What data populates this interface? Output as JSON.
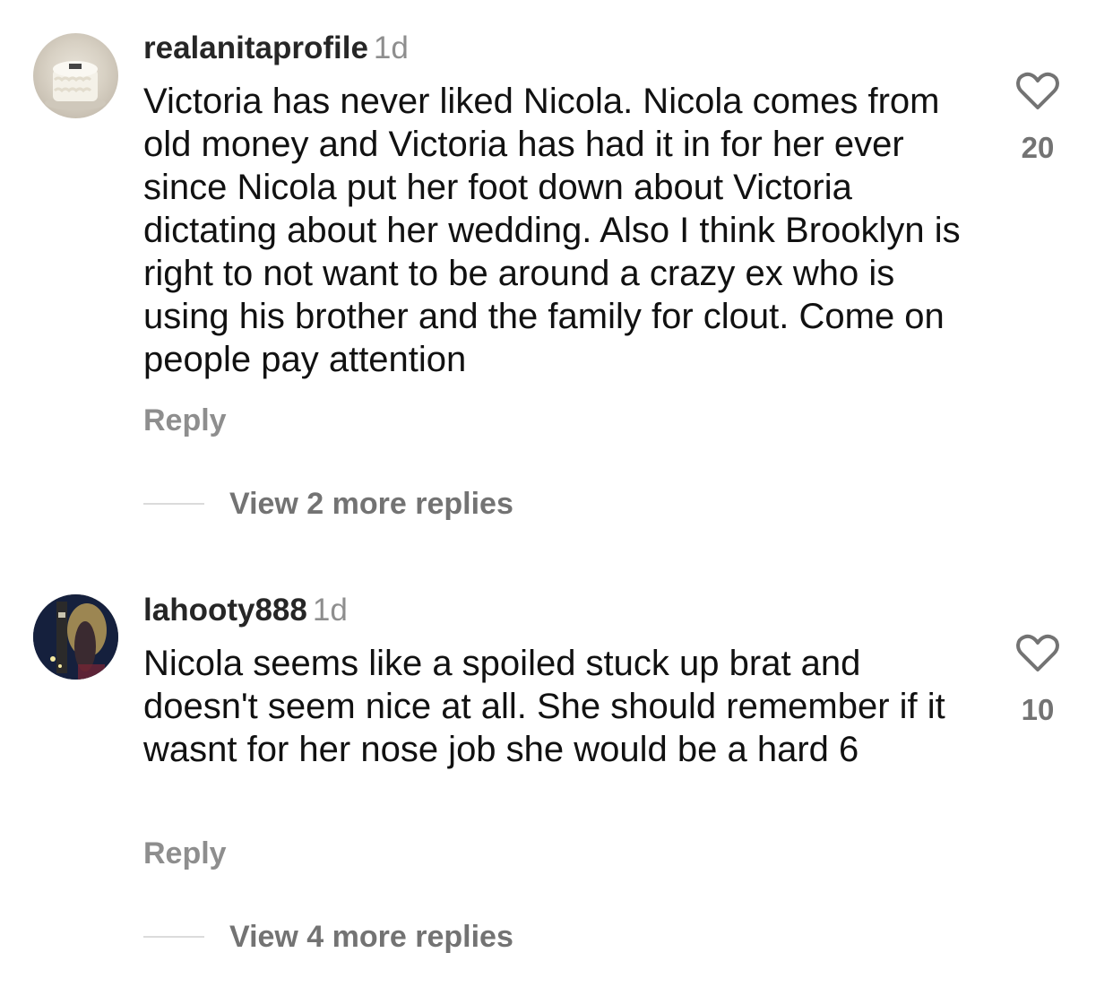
{
  "comments": [
    {
      "username": "realanitaprofile",
      "time": "1d",
      "text": "Victoria has never liked Nicola. Nicola comes from old money and Victoria has had it in for her ever since Nicola put her foot down about Victoria dictating about her wedding. Also I think Brooklyn is right to not want to be around a crazy ex who is using his brother and the family for clout. Come on people pay attention",
      "reply_label": "Reply",
      "view_replies_label": "View 2 more replies",
      "like_count": "20",
      "like_icon": "heart-outline-icon"
    },
    {
      "username": "lahooty888",
      "time": "1d",
      "text": "Nicola seems like a spoiled stuck up brat and doesn't seem nice at all.  She should remember if it wasnt for her nose job she would be a hard 6",
      "reply_label": "Reply",
      "view_replies_label": "View 4 more replies",
      "like_count": "10",
      "like_icon": "heart-outline-icon"
    }
  ],
  "colors": {
    "text": "#111111",
    "username": "#262626",
    "secondary": "#8e8e8e",
    "divider": "#dbdbdb"
  }
}
